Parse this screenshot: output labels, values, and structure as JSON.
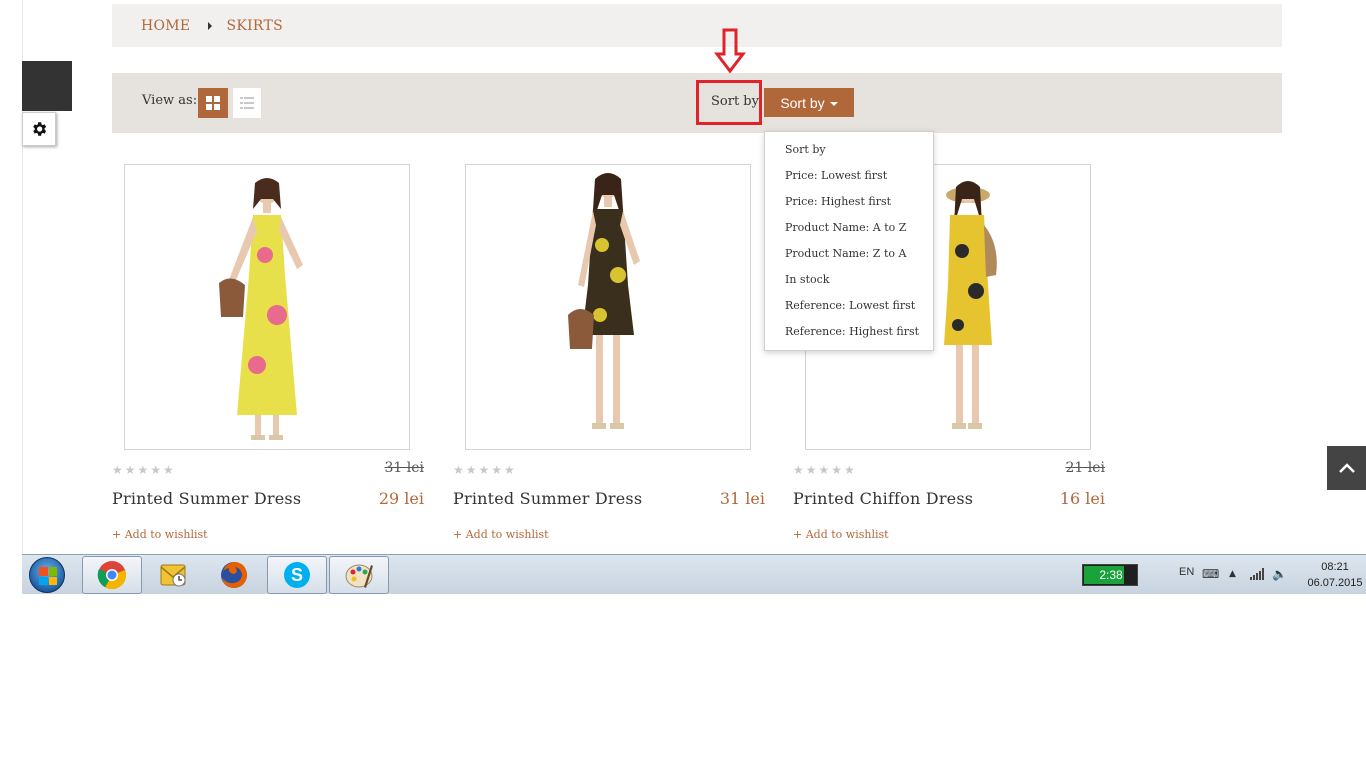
{
  "breadcrumb": {
    "home": "HOME",
    "current": "SKIRTS"
  },
  "toolbar": {
    "view_as_label": "View as:",
    "sort_label": "Sort by",
    "sort_button_label": "Sort by"
  },
  "sort_menu": {
    "options": [
      "Sort by",
      "Price: Lowest first",
      "Price: Highest first",
      "Product Name: A to Z",
      "Product Name: Z to A",
      "In stock",
      "Reference: Lowest first",
      "Reference: Highest first"
    ]
  },
  "products": [
    {
      "name": "Printed Summer Dress",
      "price": "29 lei",
      "old_price": "31 lei",
      "stars": "★★★★★",
      "wishlist": "+ Add to wishlist",
      "dress_color": "#e8e04a",
      "dress_accent": "#e86a8c"
    },
    {
      "name": "Printed Summer Dress",
      "price": "31 lei",
      "old_price": "",
      "stars": "★★★★★",
      "wishlist": "+ Add to wishlist",
      "dress_color": "#3a2f1c",
      "dress_accent": "#d8c430"
    },
    {
      "name": "Printed Chiffon Dress",
      "price": "16 lei",
      "old_price": "21 lei",
      "stars": "★★★★★",
      "wishlist": "+ Add to wishlist",
      "dress_color": "#e6c430",
      "dress_accent": "#2a2a2a"
    }
  ],
  "taskbar": {
    "apps": [
      "chrome-icon",
      "outlook-icon",
      "firefox-icon",
      "skype-icon",
      "paint-icon"
    ],
    "battery_text": "2:38",
    "language": "EN",
    "time": "08:21",
    "date": "06.07.2015"
  },
  "colors": {
    "accent": "#b0683a",
    "annotation": "#e2222a",
    "toolbar_bg": "#e6e2de"
  }
}
